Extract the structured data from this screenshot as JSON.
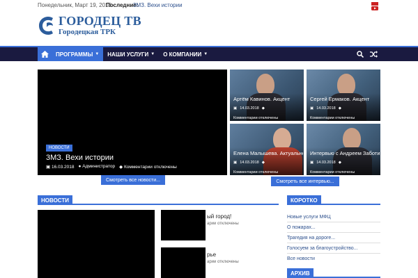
{
  "topbar": {
    "date": "Понедельник, Март 19, 2018",
    "latest_label": "Последние:",
    "latest_link": "3МЗ. Вехи истории"
  },
  "logo": {
    "title": "ГОРОДЕЦ ТВ",
    "subtitle": "Городецкая ТРК"
  },
  "nav": {
    "items": [
      {
        "label": "ПРОГРАММЫ",
        "active": true
      },
      {
        "label": "НАШИ УСЛУГИ",
        "active": false
      },
      {
        "label": "О КОМПАНИИ",
        "active": false
      }
    ]
  },
  "featured": {
    "badge": "НОВОСТИ",
    "title": "3МЗ. Вехи истории",
    "date": "16.03.2018",
    "author": "Администратор",
    "comments": "Комментарии отключены"
  },
  "interviews": [
    {
      "title": "Артём Кавинов. Акцент",
      "date": "14.03.2018",
      "comments": "Комментарии отключены"
    },
    {
      "title": "Сергей Ермаков. Акцент",
      "date": "14.03.2018",
      "comments": "Комментарии отключены"
    },
    {
      "title": "Елена Малышева. Актуальное интервью",
      "date": "14.03.2018",
      "comments": "Комментарии отключены"
    },
    {
      "title": "Интервью с Андреем Заботиным",
      "date": "14.03.2018",
      "comments": "Комментарии отключены"
    }
  ],
  "buttons": {
    "all_news": "Смотреть все новости...",
    "all_interviews": "Смотреть все интервью..."
  },
  "news_section": {
    "label": "НОВОСТИ",
    "items": [
      {
        "title": "ый город!",
        "meta": "арии отключены"
      },
      {
        "title": "рье",
        "meta": "арии отключены"
      }
    ]
  },
  "short_section": {
    "label": "КОРОТКО",
    "items": [
      "Новые услуги МФЦ",
      "О пожарах...",
      "Трагедия на дороге...",
      "Голосуем за благоустройство..."
    ],
    "all_link": "Все новости"
  },
  "archive_section": {
    "label": "АРХИВ"
  },
  "colors": {
    "accent": "#3a6fd8",
    "nav_bg": "#1a1a40",
    "logo_blue": "#2c5d9c"
  }
}
